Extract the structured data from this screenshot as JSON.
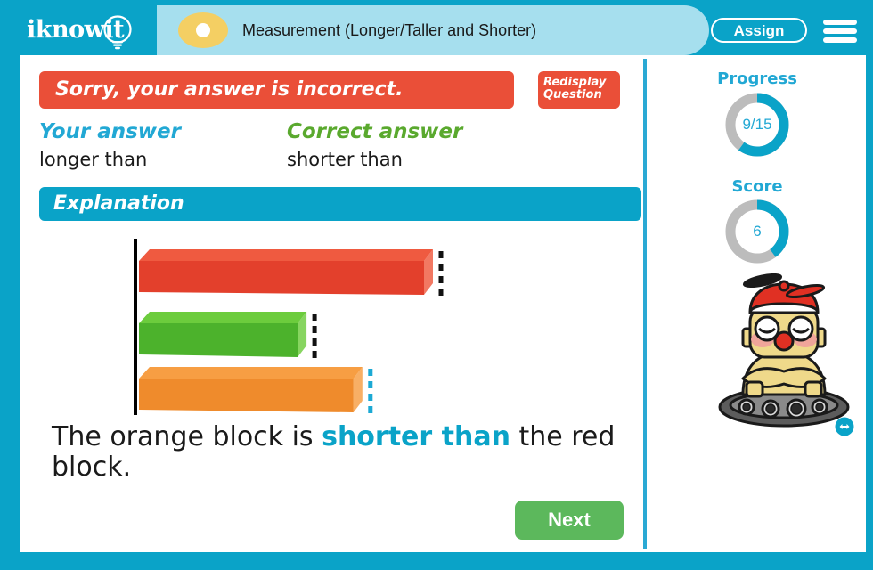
{
  "header": {
    "logo_text": "iknowit",
    "logo_icon": "lightbulb-icon",
    "lesson_title": "Measurement (Longer/Taller and Shorter)",
    "assign_label": "Assign",
    "menu_icon": "hamburger-menu-icon"
  },
  "feedback": {
    "banner_text": "Sorry, your answer is incorrect.",
    "banner_color": "#ea4f38",
    "redisplay_line1": "Redisplay",
    "redisplay_line2": "Question",
    "your_answer_label": "Your answer",
    "your_answer_value": "longer than",
    "your_answer_color": "#22a8d4",
    "correct_answer_label": "Correct answer",
    "correct_answer_value": "shorter than",
    "correct_answer_color": "#5aa92e"
  },
  "explanation": {
    "heading": "Explanation",
    "heading_color": "#0aa3c8",
    "sentence_prefix": "The orange block is ",
    "sentence_highlight": "shorter than",
    "sentence_suffix": " the red block.",
    "highlight_color": "#0aa3c8",
    "blocks": [
      {
        "name": "red-block",
        "color": "#e3402c",
        "top_color": "#ef5a40",
        "length_pct": 100,
        "marker_color": "#111111"
      },
      {
        "name": "green-block",
        "color": "#4cb22c",
        "top_color": "#6ccc3d",
        "length_pct": 57,
        "marker_color": "#111111"
      },
      {
        "name": "orange-block",
        "color": "#ef8b2c",
        "top_color": "#f79e43",
        "length_pct": 76,
        "marker_color": "#1ba9d4"
      }
    ],
    "baseline_color": "#000000"
  },
  "actions": {
    "next_label": "Next",
    "next_color": "#5cb85c"
  },
  "sidebar": {
    "progress_label": "Progress",
    "progress_value": "9/15",
    "progress_pct": 60,
    "score_label": "Score",
    "score_value": "6",
    "score_pct": 40,
    "ring_fill_color": "#0aa3c8",
    "ring_track_color": "#bcbcbc",
    "mascot_icon": "robot-mascot-propeller-hat-icon",
    "resize_icon": "resize-horizontal-icon"
  }
}
